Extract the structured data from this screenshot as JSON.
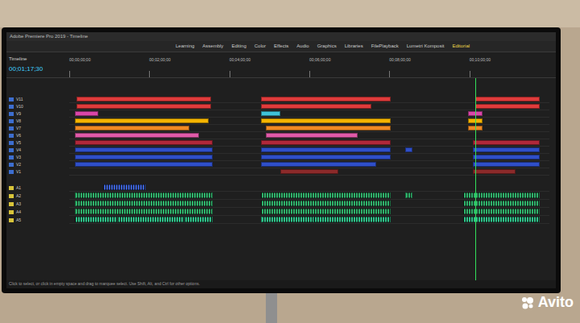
{
  "window": {
    "title": "Adobe Premiere Pro 2019 - Timeline"
  },
  "workspaces": [
    {
      "label": "Learning",
      "selected": false
    },
    {
      "label": "Assembly",
      "selected": false
    },
    {
      "label": "Editing",
      "selected": false
    },
    {
      "label": "Color",
      "selected": false
    },
    {
      "label": "Effects",
      "selected": false
    },
    {
      "label": "Audio",
      "selected": false
    },
    {
      "label": "Graphics",
      "selected": false
    },
    {
      "label": "Libraries",
      "selected": false
    },
    {
      "label": "FilePlayback",
      "selected": false
    },
    {
      "label": "Lumetri Komposit",
      "selected": false
    },
    {
      "label": "Editorial",
      "selected": true
    }
  ],
  "sequence": {
    "tab": "Timeline",
    "timecode": "00;01;17;30"
  },
  "ruler": [
    "00;00;00;00",
    "00;02;00;00",
    "00;04;00;00",
    "00;06;00;00",
    "00;08;00;00",
    "00;10;00;00"
  ],
  "playhead": 84.5,
  "tracks": [
    {
      "name": "V11",
      "kind": "video",
      "segments": [
        {
          "start": 1.5,
          "end": 29.5,
          "color": "#e03b3b"
        },
        {
          "start": 40,
          "end": 67,
          "color": "#e03b3b"
        },
        {
          "start": 84.5,
          "end": 98,
          "color": "#e03b3b"
        }
      ]
    },
    {
      "name": "V10",
      "kind": "video",
      "segments": [
        {
          "start": 1.5,
          "end": 29.5,
          "color": "#e03b3b"
        },
        {
          "start": 40,
          "end": 63,
          "color": "#e03b3b"
        },
        {
          "start": 84.5,
          "end": 98,
          "color": "#e03b3b"
        }
      ]
    },
    {
      "name": "V9",
      "kind": "video",
      "segments": [
        {
          "start": 1.2,
          "end": 6,
          "color": "#d946a8"
        },
        {
          "start": 40,
          "end": 44,
          "color": "#3fc1d8"
        },
        {
          "start": 83,
          "end": 86,
          "color": "#d946a8"
        }
      ]
    },
    {
      "name": "V8",
      "kind": "video",
      "segments": [
        {
          "start": 1.2,
          "end": 29,
          "color": "#f4b400"
        },
        {
          "start": 40,
          "end": 67,
          "color": "#f4b400"
        },
        {
          "start": 83,
          "end": 86,
          "color": "#f4b400"
        }
      ]
    },
    {
      "name": "V7",
      "kind": "video",
      "segments": [
        {
          "start": 1.2,
          "end": 25,
          "color": "#f08a24"
        },
        {
          "start": 41,
          "end": 67,
          "color": "#f08a24"
        },
        {
          "start": 83,
          "end": 86,
          "color": "#f08a24"
        }
      ]
    },
    {
      "name": "V6",
      "kind": "video",
      "segments": [
        {
          "start": 1.2,
          "end": 27,
          "color": "#e05aa8"
        },
        {
          "start": 41,
          "end": 60,
          "color": "#e05aa8"
        }
      ]
    },
    {
      "name": "V5",
      "kind": "video",
      "segments": [
        {
          "start": 1.2,
          "end": 29.8,
          "color": "#b0283a"
        },
        {
          "start": 40,
          "end": 67,
          "color": "#b0283a"
        },
        {
          "start": 84,
          "end": 98,
          "color": "#b0283a"
        }
      ]
    },
    {
      "name": "V4",
      "kind": "video",
      "segments": [
        {
          "start": 1.2,
          "end": 29.8,
          "color": "#2f4fc8"
        },
        {
          "start": 40,
          "end": 67,
          "color": "#2f4fc8"
        },
        {
          "start": 70,
          "end": 71.5,
          "color": "#2f4fc8"
        },
        {
          "start": 84,
          "end": 98,
          "color": "#2f4fc8"
        }
      ]
    },
    {
      "name": "V3",
      "kind": "video",
      "segments": [
        {
          "start": 1.2,
          "end": 29.8,
          "color": "#2f4fc8"
        },
        {
          "start": 40,
          "end": 67,
          "color": "#2f4fc8"
        },
        {
          "start": 84,
          "end": 98,
          "color": "#2f4fc8"
        }
      ]
    },
    {
      "name": "V2",
      "kind": "video",
      "segments": [
        {
          "start": 1.2,
          "end": 29.8,
          "color": "#2f4fc8"
        },
        {
          "start": 40,
          "end": 64,
          "color": "#2f4fc8"
        },
        {
          "start": 84,
          "end": 98,
          "color": "#2f4fc8"
        }
      ]
    },
    {
      "name": "V1",
      "kind": "video",
      "segments": [
        {
          "start": 44,
          "end": 56,
          "color": "#8b2a2a"
        },
        {
          "start": 84,
          "end": 93,
          "color": "#8b2a2a"
        }
      ]
    },
    {
      "name": "A1",
      "kind": "audio",
      "segments": [
        {
          "start": 7,
          "end": 16,
          "color": "#3b5fd0"
        }
      ]
    },
    {
      "name": "A2",
      "kind": "audio",
      "segments": [
        {
          "start": 1.2,
          "end": 29.8,
          "color": "#2fb36b"
        },
        {
          "start": 40,
          "end": 67,
          "color": "#2fb36b"
        },
        {
          "start": 70,
          "end": 71.5,
          "color": "#2fb36b"
        },
        {
          "start": 82,
          "end": 98,
          "color": "#2fb36b"
        }
      ]
    },
    {
      "name": "A3",
      "kind": "audio",
      "segments": [
        {
          "start": 1.2,
          "end": 29.8,
          "color": "#2fb36b"
        },
        {
          "start": 40,
          "end": 67,
          "color": "#2fb36b"
        },
        {
          "start": 82,
          "end": 98,
          "color": "#2fb36b"
        }
      ]
    },
    {
      "name": "A4",
      "kind": "audio",
      "segments": [
        {
          "start": 1.2,
          "end": 29.8,
          "color": "#2fb36b"
        },
        {
          "start": 40,
          "end": 67,
          "color": "#2fb36b"
        },
        {
          "start": 82,
          "end": 98,
          "color": "#2fb36b"
        }
      ]
    },
    {
      "name": "A5",
      "kind": "audio",
      "segments": [
        {
          "start": 1.2,
          "end": 10,
          "color": "#2ec48a"
        },
        {
          "start": 10,
          "end": 24,
          "color": "#2ec48a"
        },
        {
          "start": 24,
          "end": 29.8,
          "color": "#2ec48a"
        },
        {
          "start": 40,
          "end": 51,
          "color": "#2ec48a"
        },
        {
          "start": 51,
          "end": 67,
          "color": "#2ec48a"
        },
        {
          "start": 82,
          "end": 98,
          "color": "#2ec48a"
        }
      ]
    }
  ],
  "status_bar": "Click to select, or click in empty space and drag to marquee select. Use Shift, Alt, and Ctrl for other options.",
  "watermark": "Avito"
}
